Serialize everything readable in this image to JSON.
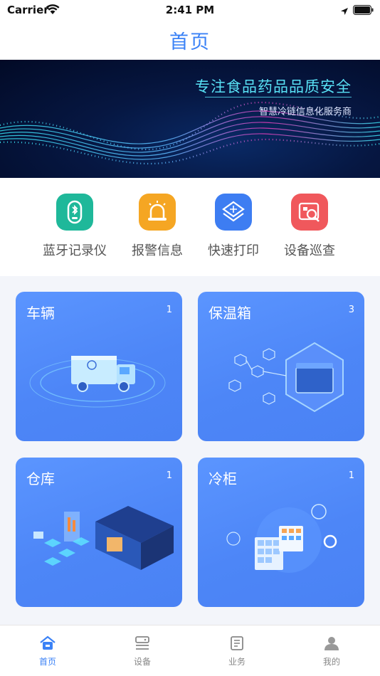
{
  "status_bar": {
    "carrier": "Carrier",
    "time": "2:41 PM"
  },
  "header": {
    "title": "首页"
  },
  "banner": {
    "title": "专注食品药品品质安全",
    "subtitle": "智慧冷链信息化服务商"
  },
  "quick_actions": [
    {
      "label": "蓝牙记录仪",
      "icon": "bluetooth-recorder-icon",
      "color": "#1fb89a"
    },
    {
      "label": "报警信息",
      "icon": "alarm-icon",
      "color": "#f5a623"
    },
    {
      "label": "快速打印",
      "icon": "print-layers-icon",
      "color": "#3d7df2"
    },
    {
      "label": "设备巡查",
      "icon": "inspection-icon",
      "color": "#f0585c"
    }
  ],
  "cards": [
    {
      "title": "车辆",
      "count": "1"
    },
    {
      "title": "保温箱",
      "count": "3"
    },
    {
      "title": "仓库",
      "count": "1"
    },
    {
      "title": "冷柜",
      "count": "1"
    }
  ],
  "tabs": [
    {
      "label": "首页",
      "icon": "home-icon",
      "active": true
    },
    {
      "label": "设备",
      "icon": "device-icon",
      "active": false
    },
    {
      "label": "业务",
      "icon": "business-icon",
      "active": false
    },
    {
      "label": "我的",
      "icon": "profile-icon",
      "active": false
    }
  ],
  "colors": {
    "accent": "#3b82f6",
    "card": "#4d86f7",
    "grid_bg": "#f3f5fa"
  }
}
